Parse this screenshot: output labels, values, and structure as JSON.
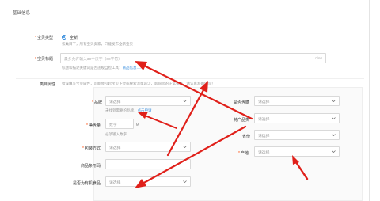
{
  "section": {
    "title": "基础信息"
  },
  "baby_type": {
    "label": "宝贝类型",
    "option": "全新",
    "help": "该类目下，所有宝贝卖家，只能发布全新宝贝"
  },
  "title_field": {
    "label": "宝贝标题",
    "placeholder": "最多允许输入30个汉字（60字符）",
    "counter": "0/60",
    "help_prefix": "标题和描述关键词是否违规自检工具：",
    "help_link": "商品信息……"
  },
  "category_attrs": {
    "label": "类目属性",
    "help": "错误填写宝贝属性，可能会引起宝贝下架或搜索流量减少，影响您的正常销售，请认真准确填写！",
    "brand": {
      "label": "品牌",
      "value": "请选择",
      "help_prefix": "未找到需要的品牌，",
      "help_link": "点击申请"
    },
    "net_content": {
      "label": "净含量",
      "placeholder": "数字",
      "unit": "g",
      "help": "必须输入数字"
    },
    "packaging": {
      "label": "包装方式",
      "value": "请选择"
    },
    "barcode": {
      "label": "商品条形码"
    },
    "organic": {
      "label": "是否为有机食品",
      "value": "请选择"
    },
    "sugar": {
      "label": "是否含糖",
      "value": "请选择"
    },
    "origin_product": {
      "label": "特产品类",
      "value": "请选择"
    },
    "province": {
      "label": "省份",
      "value": "请选择"
    },
    "place": {
      "label": "产地",
      "value": "请选择"
    }
  },
  "colors": {
    "arrow": "#e0201a",
    "link": "#3089dc",
    "required": "#ff4400"
  }
}
